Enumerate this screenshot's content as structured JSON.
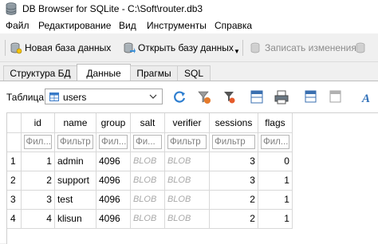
{
  "window": {
    "title": "DB Browser for SQLite - C:\\Soft\\router.db3"
  },
  "menu": [
    "Файл",
    "Редактирование",
    "Вид",
    "Инструменты",
    "Справка"
  ],
  "toolbar": {
    "new_db": "Новая база данных",
    "open_db": "Открыть базу данных",
    "write_changes": "Записать изменения"
  },
  "tabs": [
    "Структура БД",
    "Данные",
    "Прагмы",
    "SQL"
  ],
  "browse": {
    "table_label": "Таблица:",
    "table_value": "users"
  },
  "grid": {
    "columns": [
      "id",
      "name",
      "group",
      "salt",
      "verifier",
      "sessions",
      "flags"
    ],
    "filters": [
      "Фил...",
      "Фильтр",
      "Фил...",
      "Фи...",
      "Фильтр",
      "Фильтр",
      "Фил..."
    ],
    "rows": [
      {
        "rownum": "1",
        "id": "1",
        "name": "admin",
        "group": "4096",
        "salt": "BLOB",
        "verifier": "BLOB",
        "sessions": "3",
        "flags": "0"
      },
      {
        "rownum": "2",
        "id": "2",
        "name": "support",
        "group": "4096",
        "salt": "BLOB",
        "verifier": "BLOB",
        "sessions": "3",
        "flags": "1"
      },
      {
        "rownum": "3",
        "id": "3",
        "name": "test",
        "group": "4096",
        "salt": "BLOB",
        "verifier": "BLOB",
        "sessions": "2",
        "flags": "1"
      },
      {
        "rownum": "4",
        "id": "4",
        "name": "klisun",
        "group": "4096",
        "salt": "BLOB",
        "verifier": "BLOB",
        "sessions": "2",
        "flags": "1"
      }
    ]
  },
  "colors": {
    "accent": "#1e78d2",
    "blob_text": "#a8a8a8",
    "disabled_text": "#8c8c8c"
  }
}
